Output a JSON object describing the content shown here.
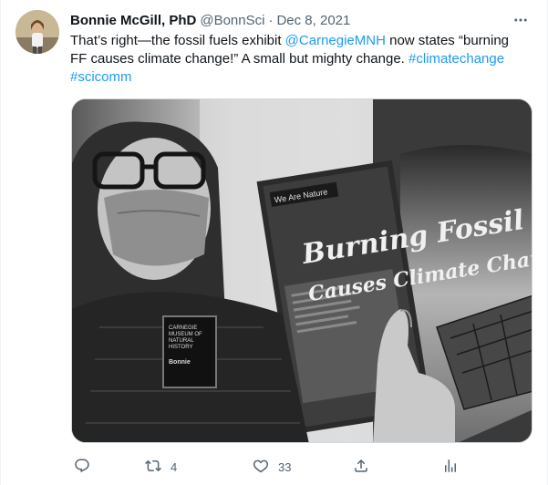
{
  "author": {
    "display_name": "Bonnie McGill, PhD",
    "handle": "@BonnSci",
    "separator": "·",
    "timestamp": "Dec 8, 2021"
  },
  "tweet": {
    "text_part1": "That’s right—the fossil fuels exhibit ",
    "mention": "@CarnegieMNH",
    "text_part2": " now states “burning FF causes climate change!” A small but mighty change. ",
    "hashtag1": "#climatechange",
    "hashtag2": "#scicomm"
  },
  "media": {
    "banner_top": "We Are Nature",
    "headline_line1": "Burning Fossil Fuels",
    "headline_line2": "Causes Climate Chang",
    "badge_line1": "CARNEGIE",
    "badge_line2": "MUSEUM OF",
    "badge_line3": "NATURAL",
    "badge_line4": "HISTORY",
    "badge_name": "Bonnie"
  },
  "actions": {
    "reply_count": "",
    "retweet_count": "4",
    "like_count": "33",
    "share_count": "",
    "analytics_count": ""
  },
  "icons": {
    "more": "more-icon",
    "reply": "reply-icon",
    "retweet": "retweet-icon",
    "like": "heart-icon",
    "share": "share-icon",
    "analytics": "analytics-icon"
  },
  "colors": {
    "link": "#1d9bf0",
    "secondary_text": "#536471",
    "primary_text": "#0f1419"
  }
}
